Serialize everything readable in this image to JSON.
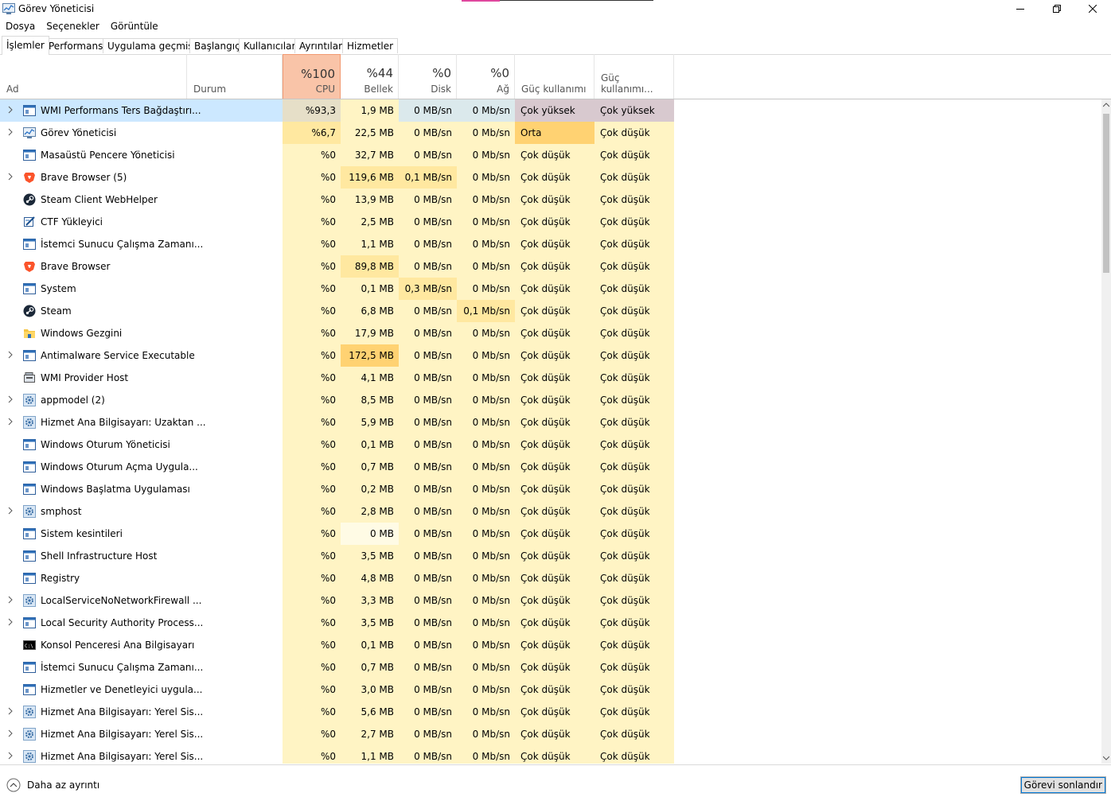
{
  "window": {
    "title": "Görev Yöneticisi"
  },
  "menu": [
    "Dosya",
    "Seçenekler",
    "Görüntüle"
  ],
  "tabs": [
    {
      "label": "İşlemler",
      "active": true
    },
    {
      "label": "Performans"
    },
    {
      "label": "Uygulama geçmişi"
    },
    {
      "label": "Başlangıç"
    },
    {
      "label": "Kullanıcılar"
    },
    {
      "label": "Ayrıntılar"
    },
    {
      "label": "Hizmetler"
    }
  ],
  "header": {
    "name": "Ad",
    "status": "Durum",
    "cpu": {
      "pct": "%100",
      "label": "CPU"
    },
    "memory": {
      "pct": "%44",
      "label": "Bellek"
    },
    "disk": {
      "pct": "%0",
      "label": "Disk"
    },
    "network": {
      "pct": "%0",
      "label": "Ağ"
    },
    "power": "Güç kullanımı",
    "power_trend": "Güç kullanımı..."
  },
  "colors": {
    "cpu_header": "#f9c4a8",
    "heat_light": "#fff4c4",
    "heat_mid": "#ffe8a0",
    "heat_high": "#ffd272",
    "very_high": "#d8c9cf",
    "medium": "#ffd272",
    "selected": "#cce8ff",
    "cpu_high": "#e6dfc8"
  },
  "processes": [
    {
      "name": "WMI Performans Ters Bağdaştırı...",
      "icon": "window-icon",
      "expand": true,
      "cpu": "%93,3",
      "mem": "1,9 MB",
      "disk": "0 MB/sn",
      "net": "0 Mb/sn",
      "power": "Çok yüksek",
      "trend": "Çok yüksek",
      "selected": true
    },
    {
      "name": "Görev Yöneticisi",
      "icon": "taskmgr-icon",
      "expand": true,
      "cpu": "%6,7",
      "mem": "22,5 MB",
      "disk": "0 MB/sn",
      "net": "0 Mb/sn",
      "power": "Orta",
      "trend": "Çok düşük"
    },
    {
      "name": "Masaüstü Pencere Yöneticisi",
      "icon": "window-icon",
      "expand": false,
      "cpu": "%0",
      "mem": "32,7 MB",
      "disk": "0 MB/sn",
      "net": "0 Mb/sn",
      "power": "Çok düşük",
      "trend": "Çok düşük"
    },
    {
      "name": "Brave Browser (5)",
      "icon": "brave-icon",
      "expand": true,
      "cpu": "%0",
      "mem": "119,6 MB",
      "disk": "0,1 MB/sn",
      "net": "0 Mb/sn",
      "power": "Çok düşük",
      "trend": "Çok düşük"
    },
    {
      "name": "Steam Client WebHelper",
      "icon": "steam-icon",
      "expand": false,
      "cpu": "%0",
      "mem": "13,9 MB",
      "disk": "0 MB/sn",
      "net": "0 Mb/sn",
      "power": "Çok düşük",
      "trend": "Çok düşük"
    },
    {
      "name": "CTF Yükleyici",
      "icon": "ctf-icon",
      "expand": false,
      "cpu": "%0",
      "mem": "2,5 MB",
      "disk": "0 MB/sn",
      "net": "0 Mb/sn",
      "power": "Çok düşük",
      "trend": "Çok düşük"
    },
    {
      "name": "İstemci Sunucu Çalışma Zamanı...",
      "icon": "window-icon",
      "expand": false,
      "cpu": "%0",
      "mem": "1,1 MB",
      "disk": "0 MB/sn",
      "net": "0 Mb/sn",
      "power": "Çok düşük",
      "trend": "Çok düşük"
    },
    {
      "name": "Brave Browser",
      "icon": "brave-icon",
      "expand": false,
      "cpu": "%0",
      "mem": "89,8 MB",
      "disk": "0 MB/sn",
      "net": "0 Mb/sn",
      "power": "Çok düşük",
      "trend": "Çok düşük"
    },
    {
      "name": "System",
      "icon": "window-icon",
      "expand": false,
      "cpu": "%0",
      "mem": "0,1 MB",
      "disk": "0,3 MB/sn",
      "net": "0 Mb/sn",
      "power": "Çok düşük",
      "trend": "Çok düşük"
    },
    {
      "name": "Steam",
      "icon": "steam-icon",
      "expand": false,
      "cpu": "%0",
      "mem": "6,8 MB",
      "disk": "0 MB/sn",
      "net": "0,1 Mb/sn",
      "power": "Çok düşük",
      "trend": "Çok düşük"
    },
    {
      "name": "Windows Gezgini",
      "icon": "folder-icon",
      "expand": false,
      "cpu": "%0",
      "mem": "17,9 MB",
      "disk": "0 MB/sn",
      "net": "0 Mb/sn",
      "power": "Çok düşük",
      "trend": "Çok düşük"
    },
    {
      "name": "Antimalware Service Executable",
      "icon": "window-icon",
      "expand": true,
      "cpu": "%0",
      "mem": "172,5 MB",
      "disk": "0 MB/sn",
      "net": "0 Mb/sn",
      "power": "Çok düşük",
      "trend": "Çok düşük"
    },
    {
      "name": "WMI Provider Host",
      "icon": "wmi-icon",
      "expand": false,
      "cpu": "%0",
      "mem": "4,1 MB",
      "disk": "0 MB/sn",
      "net": "0 Mb/sn",
      "power": "Çok düşük",
      "trend": "Çok düşük"
    },
    {
      "name": "appmodel (2)",
      "icon": "gear-icon",
      "expand": true,
      "cpu": "%0",
      "mem": "8,5 MB",
      "disk": "0 MB/sn",
      "net": "0 Mb/sn",
      "power": "Çok düşük",
      "trend": "Çok düşük"
    },
    {
      "name": "Hizmet Ana Bilgisayarı: Uzaktan ...",
      "icon": "gear-icon",
      "expand": true,
      "cpu": "%0",
      "mem": "5,9 MB",
      "disk": "0 MB/sn",
      "net": "0 Mb/sn",
      "power": "Çok düşük",
      "trend": "Çok düşük"
    },
    {
      "name": "Windows Oturum Yöneticisi",
      "icon": "window-icon",
      "expand": false,
      "cpu": "%0",
      "mem": "0,1 MB",
      "disk": "0 MB/sn",
      "net": "0 Mb/sn",
      "power": "Çok düşük",
      "trend": "Çok düşük"
    },
    {
      "name": "Windows Oturum Açma Uygula...",
      "icon": "window-icon",
      "expand": false,
      "cpu": "%0",
      "mem": "0,7 MB",
      "disk": "0 MB/sn",
      "net": "0 Mb/sn",
      "power": "Çok düşük",
      "trend": "Çok düşük"
    },
    {
      "name": "Windows Başlatma Uygulaması",
      "icon": "window-icon",
      "expand": false,
      "cpu": "%0",
      "mem": "0,2 MB",
      "disk": "0 MB/sn",
      "net": "0 Mb/sn",
      "power": "Çok düşük",
      "trend": "Çok düşük"
    },
    {
      "name": "smphost",
      "icon": "gear-icon",
      "expand": true,
      "cpu": "%0",
      "mem": "2,8 MB",
      "disk": "0 MB/sn",
      "net": "0 Mb/sn",
      "power": "Çok düşük",
      "trend": "Çok düşük"
    },
    {
      "name": "Sistem kesintileri",
      "icon": "window-icon",
      "expand": false,
      "cpu": "%0",
      "mem": "0 MB",
      "disk": "0 MB/sn",
      "net": "0 Mb/sn",
      "power": "Çok düşük",
      "trend": "Çok düşük"
    },
    {
      "name": "Shell Infrastructure Host",
      "icon": "window-icon",
      "expand": false,
      "cpu": "%0",
      "mem": "3,5 MB",
      "disk": "0 MB/sn",
      "net": "0 Mb/sn",
      "power": "Çok düşük",
      "trend": "Çok düşük"
    },
    {
      "name": "Registry",
      "icon": "window-icon",
      "expand": false,
      "cpu": "%0",
      "mem": "4,8 MB",
      "disk": "0 MB/sn",
      "net": "0 Mb/sn",
      "power": "Çok düşük",
      "trend": "Çok düşük"
    },
    {
      "name": "LocalServiceNoNetworkFirewall ...",
      "icon": "gear-icon",
      "expand": true,
      "cpu": "%0",
      "mem": "3,3 MB",
      "disk": "0 MB/sn",
      "net": "0 Mb/sn",
      "power": "Çok düşük",
      "trend": "Çok düşük"
    },
    {
      "name": "Local Security Authority Process...",
      "icon": "window-icon",
      "expand": true,
      "cpu": "%0",
      "mem": "3,5 MB",
      "disk": "0 MB/sn",
      "net": "0 Mb/sn",
      "power": "Çok düşük",
      "trend": "Çok düşük"
    },
    {
      "name": "Konsol Penceresi Ana Bilgisayarı",
      "icon": "console-icon",
      "expand": false,
      "cpu": "%0",
      "mem": "0,1 MB",
      "disk": "0 MB/sn",
      "net": "0 Mb/sn",
      "power": "Çok düşük",
      "trend": "Çok düşük"
    },
    {
      "name": "İstemci Sunucu Çalışma Zamanı...",
      "icon": "window-icon",
      "expand": false,
      "cpu": "%0",
      "mem": "0,7 MB",
      "disk": "0 MB/sn",
      "net": "0 Mb/sn",
      "power": "Çok düşük",
      "trend": "Çok düşük"
    },
    {
      "name": "Hizmetler ve Denetleyici uygula...",
      "icon": "window-icon",
      "expand": false,
      "cpu": "%0",
      "mem": "3,0 MB",
      "disk": "0 MB/sn",
      "net": "0 Mb/sn",
      "power": "Çok düşük",
      "trend": "Çok düşük"
    },
    {
      "name": "Hizmet Ana Bilgisayarı: Yerel Sis...",
      "icon": "gear-icon",
      "expand": true,
      "cpu": "%0",
      "mem": "5,6 MB",
      "disk": "0 MB/sn",
      "net": "0 Mb/sn",
      "power": "Çok düşük",
      "trend": "Çok düşük"
    },
    {
      "name": "Hizmet Ana Bilgisayarı: Yerel Sis...",
      "icon": "gear-icon",
      "expand": true,
      "cpu": "%0",
      "mem": "2,7 MB",
      "disk": "0 MB/sn",
      "net": "0 Mb/sn",
      "power": "Çok düşük",
      "trend": "Çok düşük"
    },
    {
      "name": "Hizmet Ana Bilgisayarı: Yerel Sis...",
      "icon": "gear-icon",
      "expand": true,
      "cpu": "%0",
      "mem": "1,1 MB",
      "disk": "0 MB/sn",
      "net": "0 Mb/sn",
      "power": "Çok düşük",
      "trend": "Çok düşük"
    }
  ],
  "footer": {
    "less_details": "Daha az ayrıntı",
    "end_task": "Görevi sonlandır"
  }
}
